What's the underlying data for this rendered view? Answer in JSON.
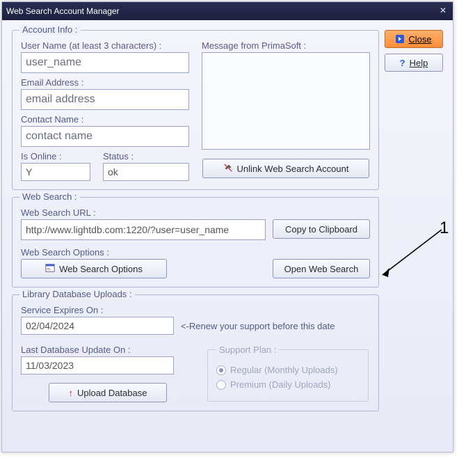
{
  "window": {
    "title": "Web Search Account Manager"
  },
  "side_buttons": {
    "close": "Close",
    "help": "Help"
  },
  "account_info": {
    "legend": "Account Info :",
    "username_label": "User Name (at least 3 characters) :",
    "username_value": "user_name",
    "email_label": "Email Address :",
    "email_value": "email address",
    "contact_label": "Contact Name :",
    "contact_value": "contact name",
    "isonline_label": "Is Online :",
    "isonline_value": "Y",
    "status_label": "Status :",
    "status_value": "ok",
    "message_label": "Message from PrimaSoft :",
    "message_value": "",
    "unlink_button": "Unlink Web Search Account"
  },
  "web_search": {
    "legend": "Web Search :",
    "url_label": "Web Search URL :",
    "url_value": "http://www.lightdb.com:1220/?user=user_name",
    "copy_button": "Copy to Clipboard",
    "options_label": "Web Search Options :",
    "options_button": "Web Search Options",
    "open_button": "Open Web Search"
  },
  "library": {
    "legend": "Library Database Uploads :",
    "expires_label": "Service Expires On :",
    "expires_value": "02/04/2024",
    "renew_hint": "<-Renew your support before this date",
    "lastupdate_label": "Last Database Update On :",
    "lastupdate_value": "11/03/2023",
    "upload_button": "Upload Database",
    "support_plan": {
      "title": "Support Plan :",
      "regular": "Regular (Monthly Uploads)",
      "premium": "Premium (Daily Uploads)",
      "selected": "regular"
    }
  },
  "annotation": {
    "label": "1"
  }
}
